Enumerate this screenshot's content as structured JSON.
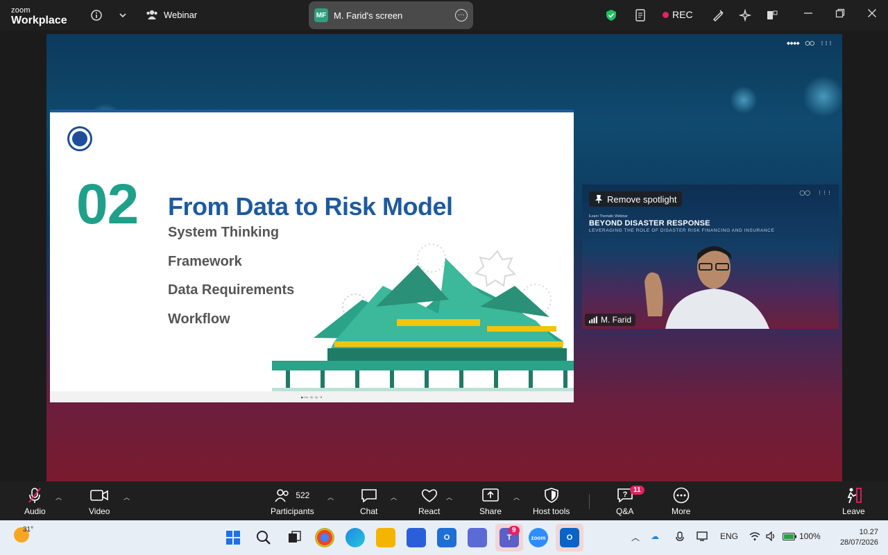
{
  "titlebar": {
    "logo_line1": "zoom",
    "logo_line2": "Workplace",
    "webinar_label": "Webinar",
    "screen_initials": "MF",
    "screen_label": "M. Farid's screen",
    "rec_label": "REC"
  },
  "slide": {
    "number": "02",
    "title": "From Data to Risk Model",
    "items": [
      "System Thinking",
      "Framework",
      "Data Requirements",
      "Workflow"
    ]
  },
  "video": {
    "spotlight_label": "Remove spotlight",
    "subtitle": "iLearn Thematic Webinar",
    "title": "BEYOND DISASTER RESPONSE",
    "title2": "LEVERAGING THE ROLE OF DISASTER RISK FINANCING AND INSURANCE",
    "speaker_name": "M. Farid"
  },
  "toolbar": {
    "audio": "Audio",
    "video": "Video",
    "participants": "Participants",
    "participants_count": "522",
    "chat": "Chat",
    "react": "React",
    "share": "Share",
    "host_tools": "Host tools",
    "qa": "Q&A",
    "qa_badge": "11",
    "more": "More",
    "leave": "Leave"
  },
  "taskbar": {
    "temperature": "31°",
    "teams_badge": "9",
    "language": "ENG",
    "battery": "100%",
    "time": "10.27",
    "date": "28/07/2026"
  },
  "colors": {
    "accent_teal": "#1fa08a",
    "title_blue": "#1e5aa0",
    "record_red": "#e0245e"
  }
}
